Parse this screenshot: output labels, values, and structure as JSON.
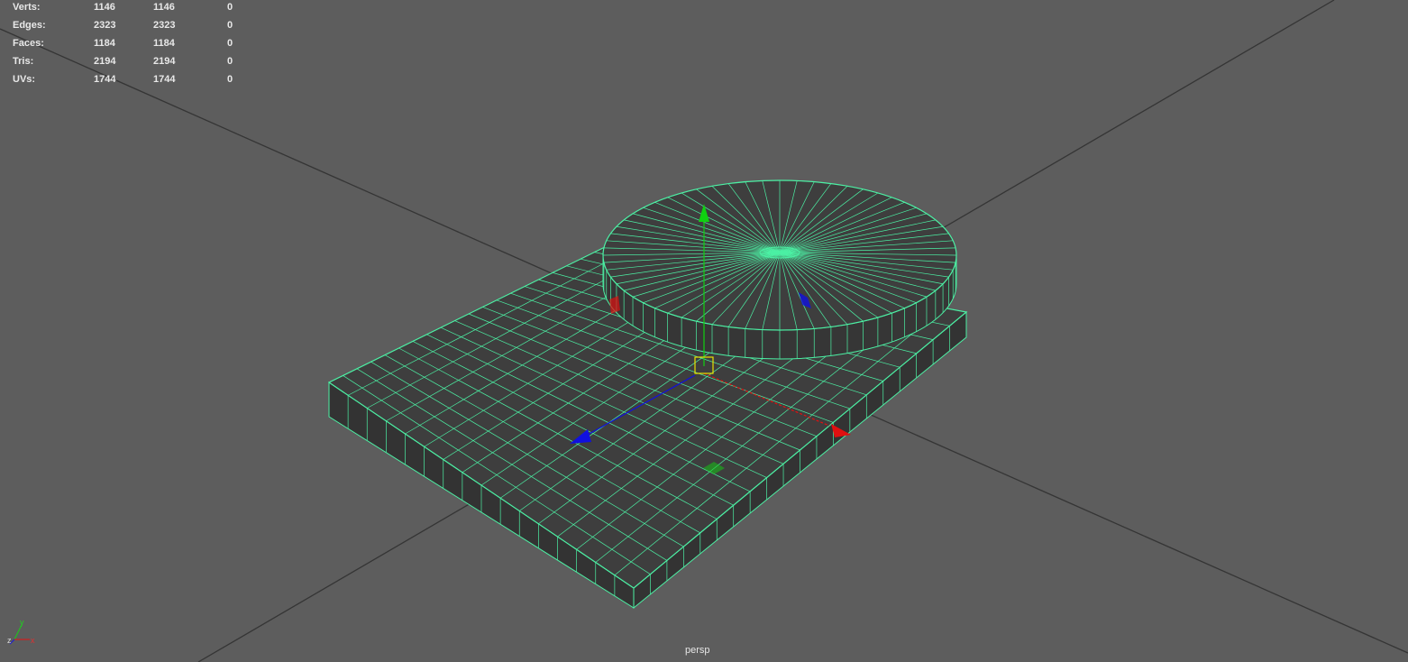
{
  "stats": [
    {
      "label": "Verts:",
      "total": "1146",
      "selected": "1146",
      "extra": "0"
    },
    {
      "label": "Edges:",
      "total": "2323",
      "selected": "2323",
      "extra": "0"
    },
    {
      "label": "Faces:",
      "total": "1184",
      "selected": "1184",
      "extra": "0"
    },
    {
      "label": "Tris:",
      "total": "2194",
      "selected": "2194",
      "extra": "0"
    },
    {
      "label": "UVs:",
      "total": "1744",
      "selected": "1744",
      "extra": "0"
    }
  ],
  "camera": "persp",
  "axis_labels": {
    "y": "y",
    "z": "z",
    "x": "x"
  },
  "colors": {
    "background": "#5d5d5d",
    "grid_line": "#3a3a3a",
    "wireframe": "#4cf0a4",
    "face": "#3e3e3e",
    "x_axis": "#e01010",
    "y_axis": "#10d010",
    "z_axis": "#1010e0",
    "pivot": "#e8e000"
  },
  "icons": [
    "move-manipulator-icon",
    "axis-orientation-icon"
  ]
}
